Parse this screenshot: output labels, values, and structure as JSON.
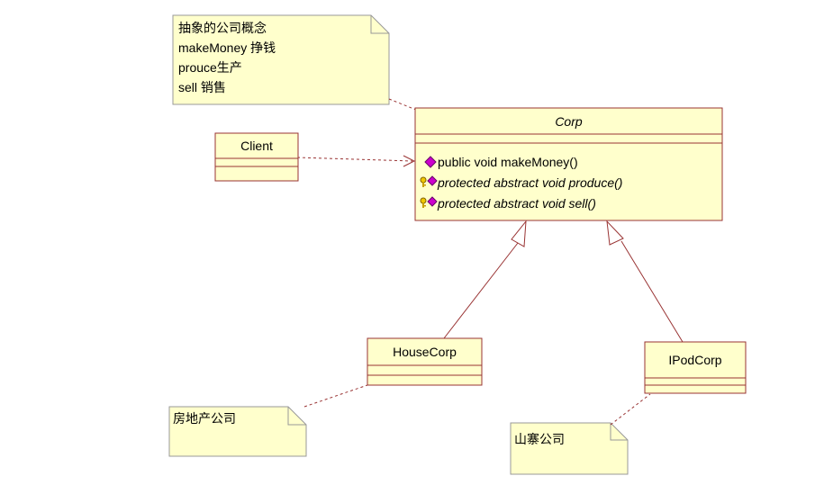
{
  "notes": {
    "corp_note": [
      "抽象的公司概念",
      "makeMoney 挣钱",
      "prouce生产",
      "sell 销售"
    ],
    "house_note": "房地产公司",
    "ipod_note": "山寨公司"
  },
  "classes": {
    "client": {
      "name": "Client"
    },
    "corp": {
      "name": "Corp",
      "abstract": true,
      "methods": [
        {
          "text": "public void makeMoney()",
          "visibility": "public",
          "icon": "public-method-icon",
          "abstract": false
        },
        {
          "text": "protected abstract void produce()",
          "visibility": "protected",
          "icon": "protected-method-key-icon",
          "abstract": true
        },
        {
          "text": "protected abstract void sell()",
          "visibility": "protected",
          "icon": "protected-method-key-icon",
          "abstract": true
        }
      ]
    },
    "housecorp": {
      "name": "HouseCorp"
    },
    "ipodcorp": {
      "name": "IPodCorp"
    }
  },
  "relations": [
    {
      "type": "dependency",
      "from": "Client",
      "to": "Corp"
    },
    {
      "type": "generalization",
      "from": "HouseCorp",
      "to": "Corp"
    },
    {
      "type": "generalization",
      "from": "IPodCorp",
      "to": "Corp"
    },
    {
      "type": "note-anchor",
      "from": "corp_note",
      "to": "Corp"
    },
    {
      "type": "note-anchor",
      "from": "house_note",
      "to": "HouseCorp"
    },
    {
      "type": "note-anchor",
      "from": "ipod_note",
      "to": "IPodCorp"
    }
  ],
  "colors": {
    "box_fill": "#FFFFCC",
    "box_stroke": "#993333",
    "note_stroke": "#999999",
    "line": "#993333",
    "public_icon": "#CC00CC",
    "key_icon": "#C8A000"
  }
}
